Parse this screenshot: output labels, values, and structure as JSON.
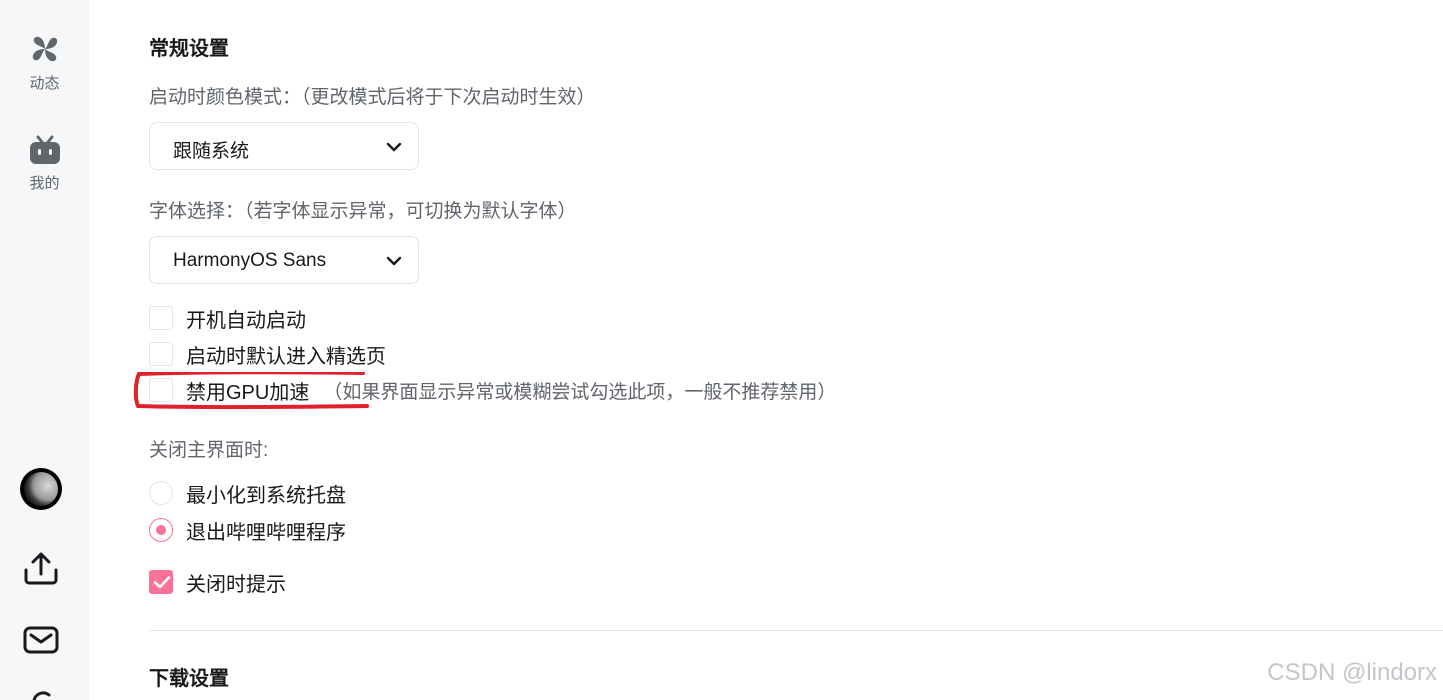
{
  "sidebar": {
    "items": [
      {
        "label": "动态",
        "icon": "pinwheel-icon"
      },
      {
        "label": "我的",
        "icon": "tv-icon"
      }
    ],
    "bottom_icons": [
      "avatar",
      "upload-icon",
      "mail-icon"
    ]
  },
  "general": {
    "title": "常规设置",
    "color_mode": {
      "label": "启动时颜色模式：（更改模式后将于下次启动时生效）",
      "value": "跟随系统"
    },
    "font": {
      "label": "字体选择：（若字体显示异常，可切换为默认字体）",
      "value": "HarmonyOS Sans"
    },
    "options": [
      {
        "label": "开机自动启动",
        "checked": false
      },
      {
        "label": "启动时默认进入精选页",
        "checked": false
      },
      {
        "label": "禁用GPU加速",
        "hint": "（如果界面显示异常或模糊尝试勾选此项，一般不推荐禁用）",
        "checked": false
      }
    ],
    "close_behavior": {
      "label": "关闭主界面时:",
      "options": [
        {
          "label": "最小化到系统托盘",
          "selected": false
        },
        {
          "label": "退出哔哩哔哩程序",
          "selected": true
        }
      ]
    },
    "close_prompt": {
      "label": "关闭时提示",
      "checked": true
    }
  },
  "download": {
    "title": "下载设置"
  },
  "watermark": "CSDN @lindorx",
  "colors": {
    "accent": "#fb7299",
    "highlight": "#e0202a",
    "sidebar_bg": "#f6f7f8"
  }
}
